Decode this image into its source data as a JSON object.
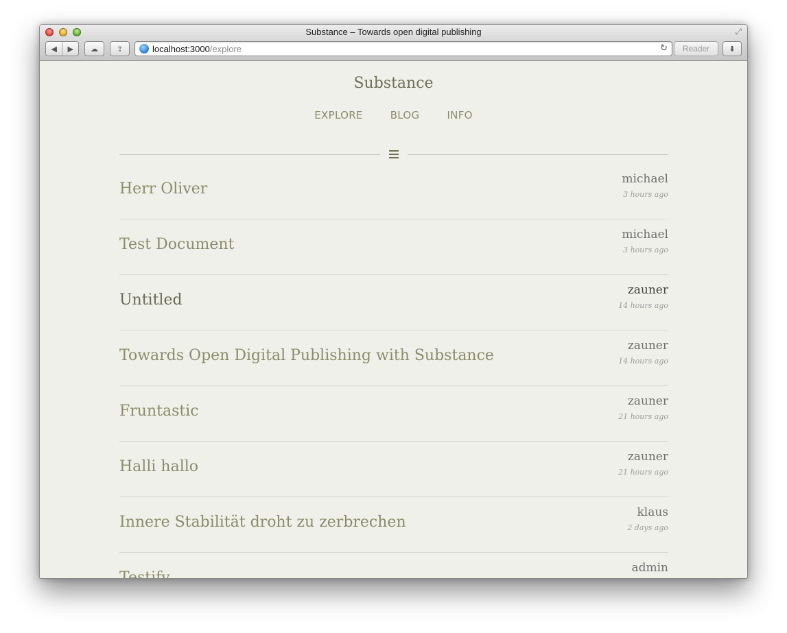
{
  "window": {
    "title": "Substance – Towards open digital publishing",
    "url_host": "localhost:3000",
    "url_path": "/explore",
    "reader_label": "Reader"
  },
  "site": {
    "brand": "Substance",
    "nav": [
      "EXPLORE",
      "BLOG",
      "INFO"
    ]
  },
  "documents": [
    {
      "title": "Herr Oliver",
      "author": "michael",
      "time": "3 hours ago"
    },
    {
      "title": "Test Document",
      "author": "michael",
      "time": "3 hours ago"
    },
    {
      "title": "Untitled",
      "author": "zauner",
      "time": "14 hours ago"
    },
    {
      "title": "Towards Open Digital Publishing with Substance",
      "author": "zauner",
      "time": "14 hours ago"
    },
    {
      "title": "Fruntastic",
      "author": "zauner",
      "time": "21 hours ago"
    },
    {
      "title": "Halli hallo",
      "author": "zauner",
      "time": "21 hours ago"
    },
    {
      "title": "Innere Stabilität droht zu zerbrechen",
      "author": "klaus",
      "time": "2 days ago"
    },
    {
      "title": "Testify",
      "author": "admin",
      "time": ""
    }
  ],
  "colors": {
    "background": "#f0f0eb",
    "title": "#8c8c6a",
    "brand": "#6f6f57"
  }
}
